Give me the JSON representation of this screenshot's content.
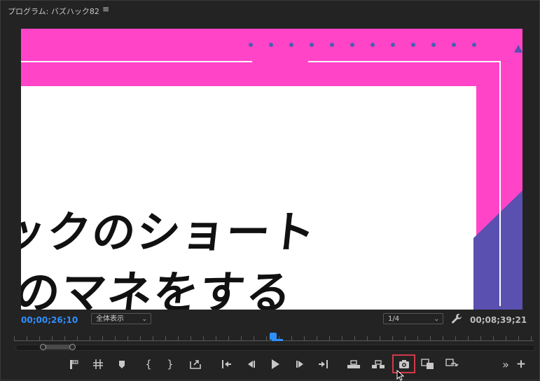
{
  "panel": {
    "title": "プログラム: バズハック82",
    "menu_icon": "hamburger-icon"
  },
  "video": {
    "caption_line1": "ックのショート",
    "caption_line2": "のマネをする",
    "colors": {
      "background": "#ff44c8",
      "card": "#ffffff",
      "accent": "#5a50b0",
      "text": "#111111"
    }
  },
  "status_bar": {
    "current_timecode": "00;00;26;10",
    "zoom_select": "全体表示",
    "resolution_select": "1/4",
    "settings_icon": "wrench-icon",
    "duration_timecode": "00;08;39;21"
  },
  "transport": {
    "buttons": [
      "add-marker-icon",
      "clear-in-out-icon",
      "marker-icon",
      "mark-in-icon",
      "mark-out-icon",
      "export-icon",
      "go-to-in-icon",
      "step-back-icon",
      "play-icon",
      "step-forward-icon",
      "go-to-out-icon",
      "lift-icon",
      "extract-icon",
      "export-frame-icon",
      "comparison-view-icon",
      "proxy-toggle-icon",
      "more-icon",
      "add-button-icon"
    ],
    "highlighted": "export-frame-icon",
    "accent_color": "#2f8fff",
    "highlight_color": "#d03a4a"
  }
}
